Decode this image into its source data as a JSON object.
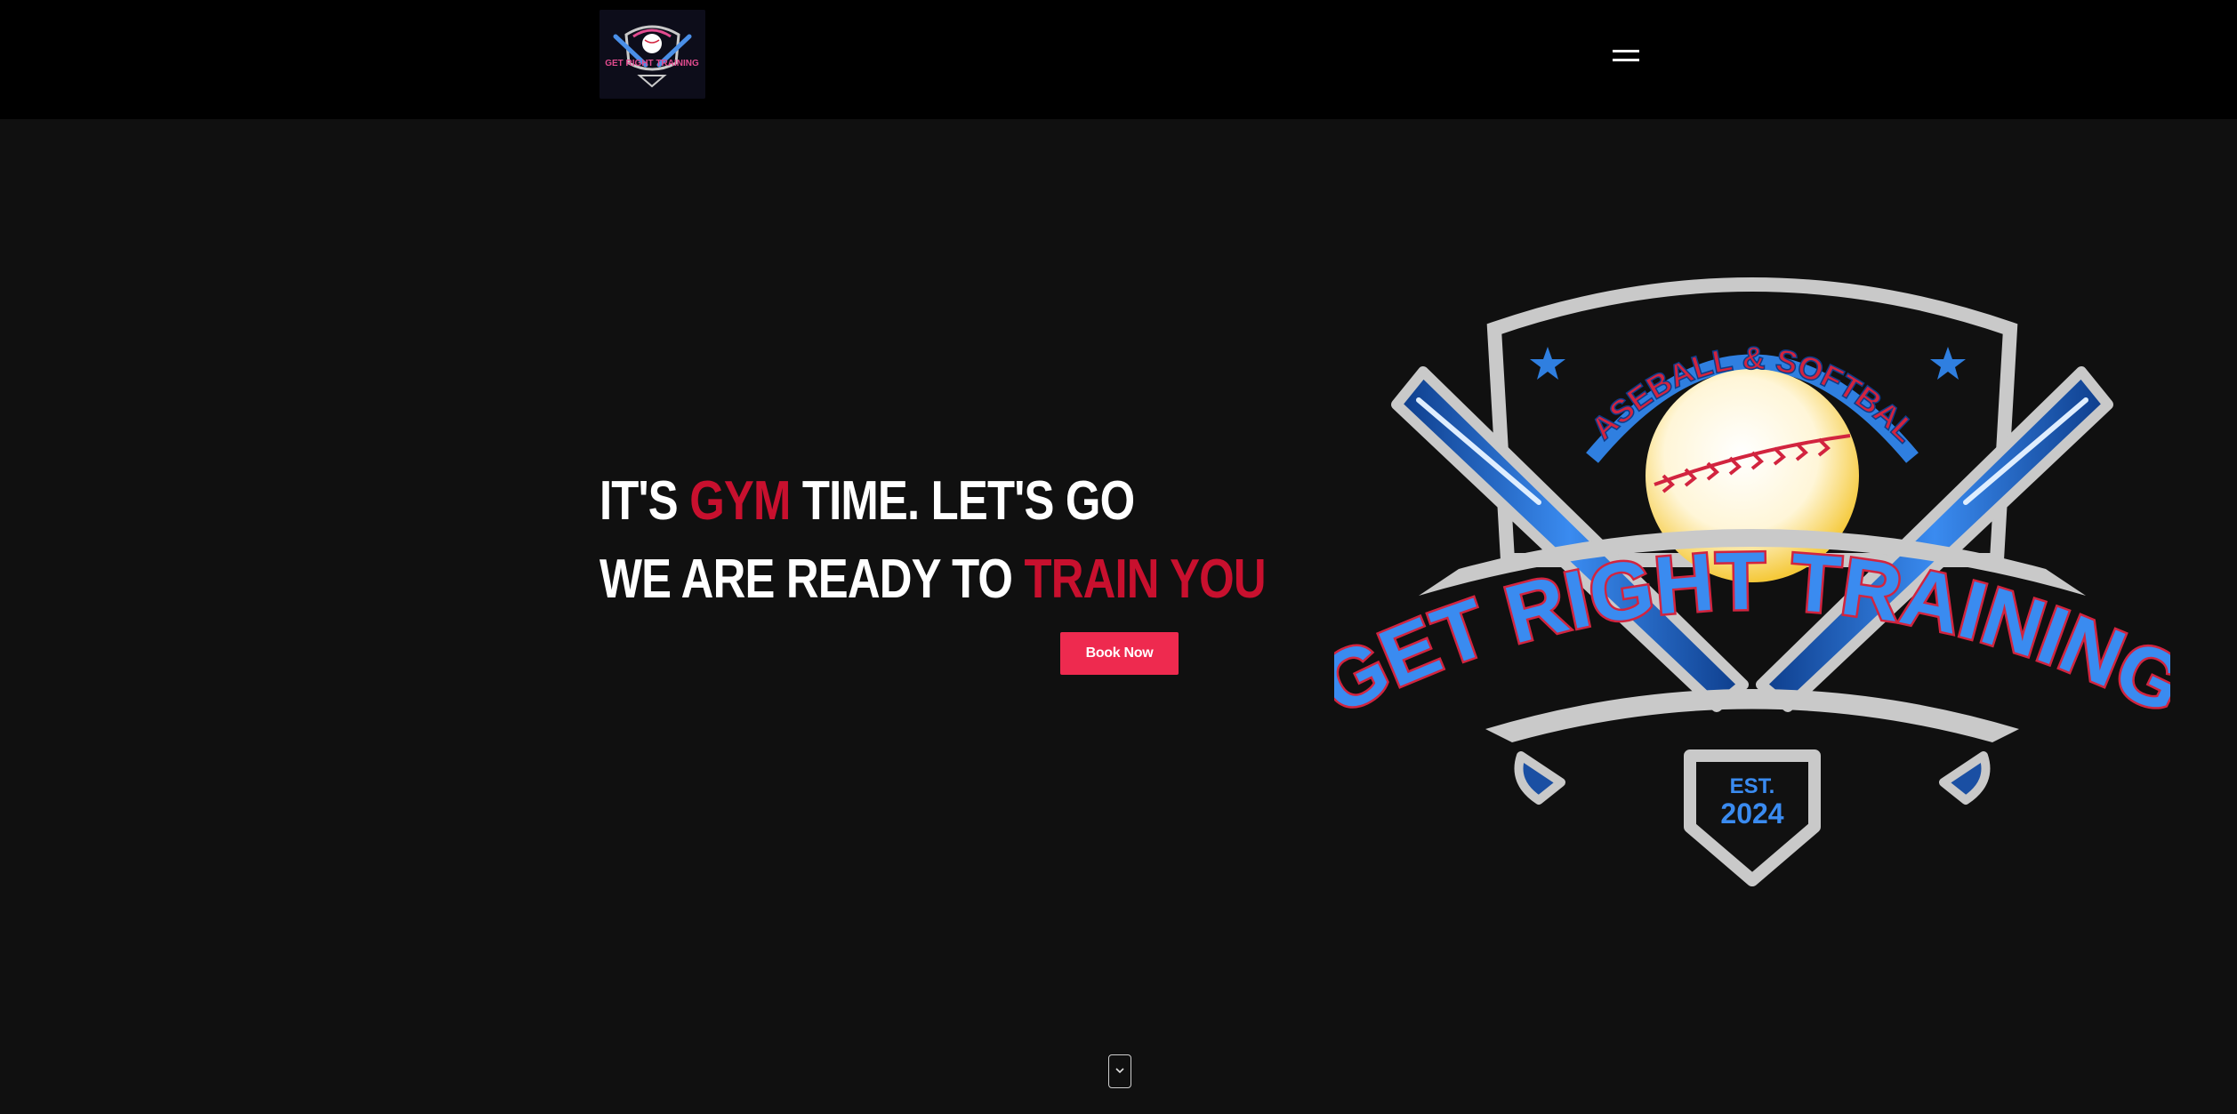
{
  "header": {
    "logo_alt": "Get Right Training logo",
    "logo_text": "GET RIGHT TRAINING",
    "menu_icon": "hamburger-menu-icon"
  },
  "hero": {
    "line1": {
      "before": "IT'S ",
      "accent": "GYM",
      "after": " TIME. LET'S GO"
    },
    "line2": {
      "before": "WE ARE READY TO ",
      "accent": "TRAIN YOU"
    },
    "button_label": "Book Now"
  },
  "logo": {
    "arc_text": "BASEBALL & SOFTBALL",
    "banner_text": "GET RIGHT TRAINING",
    "est_label": "EST.",
    "est_year": "2024"
  },
  "scroll": {
    "icon": "chevron-down-icon"
  },
  "colors": {
    "accent_red": "#c8102e",
    "button_pink": "#ee2a4f",
    "logo_blue": "#2f7fe0",
    "logo_red": "#d2243f",
    "silver": "#c9c9c9"
  }
}
